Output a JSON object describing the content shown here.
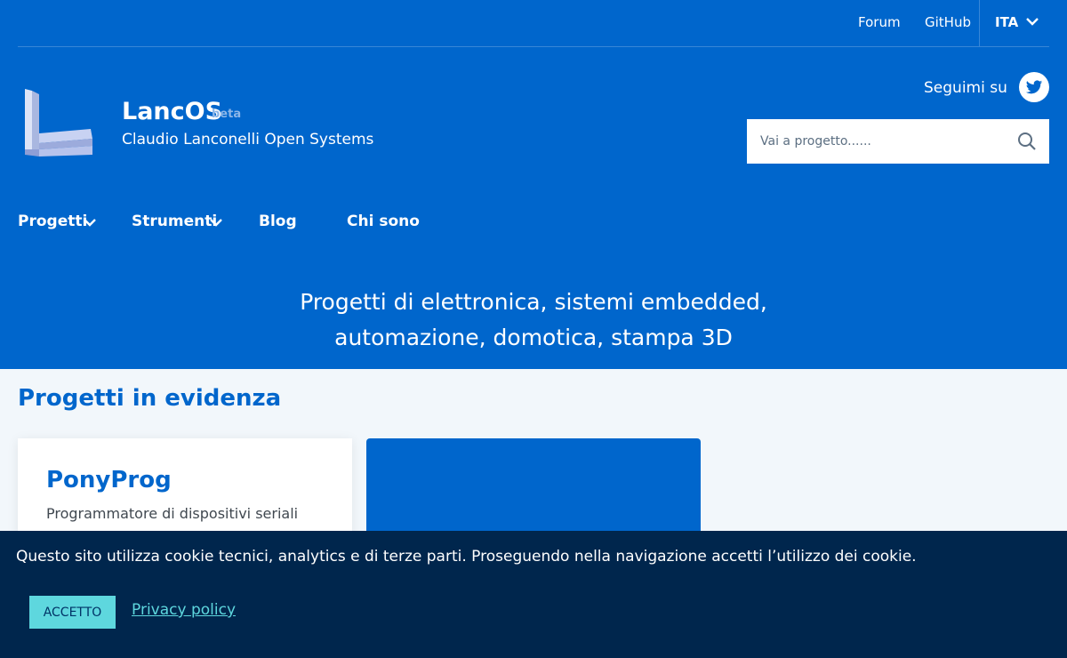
{
  "topbar": {
    "links": [
      "Forum",
      "GitHub"
    ],
    "language": "ITA"
  },
  "brand": {
    "title": "LancOS",
    "badge": "beta",
    "subtitle": "Claudio Lanconelli Open Systems"
  },
  "social": {
    "label": "Seguimi su",
    "icon": "twitter-icon"
  },
  "search": {
    "placeholder": "Vai a progetto......",
    "value": ""
  },
  "nav": {
    "items": [
      "Progetti",
      "Strumenti",
      "Blog",
      "Chi sono"
    ]
  },
  "hero": {
    "line1": "Progetti di elettronica, sistemi embedded,",
    "line2": "automazione, domotica, stampa 3D"
  },
  "featured": {
    "title": "Progetti in evidenza",
    "cards": [
      {
        "title": "PonyProg",
        "description": "Programmatore di dispositivi seriali"
      }
    ]
  },
  "cookie": {
    "message": "Questo sito utilizza cookie tecnici, analytics e di terze parti. Proseguendo nella navigazione accetti l’utilizzo dei cookie.",
    "accept_label": "ACCETTO",
    "privacy_label": "Privacy policy"
  },
  "colors": {
    "primary": "#0066cc",
    "page_bg": "#f2f7fb",
    "cookie_bg": "#00264d",
    "accent": "#5ed7de"
  }
}
